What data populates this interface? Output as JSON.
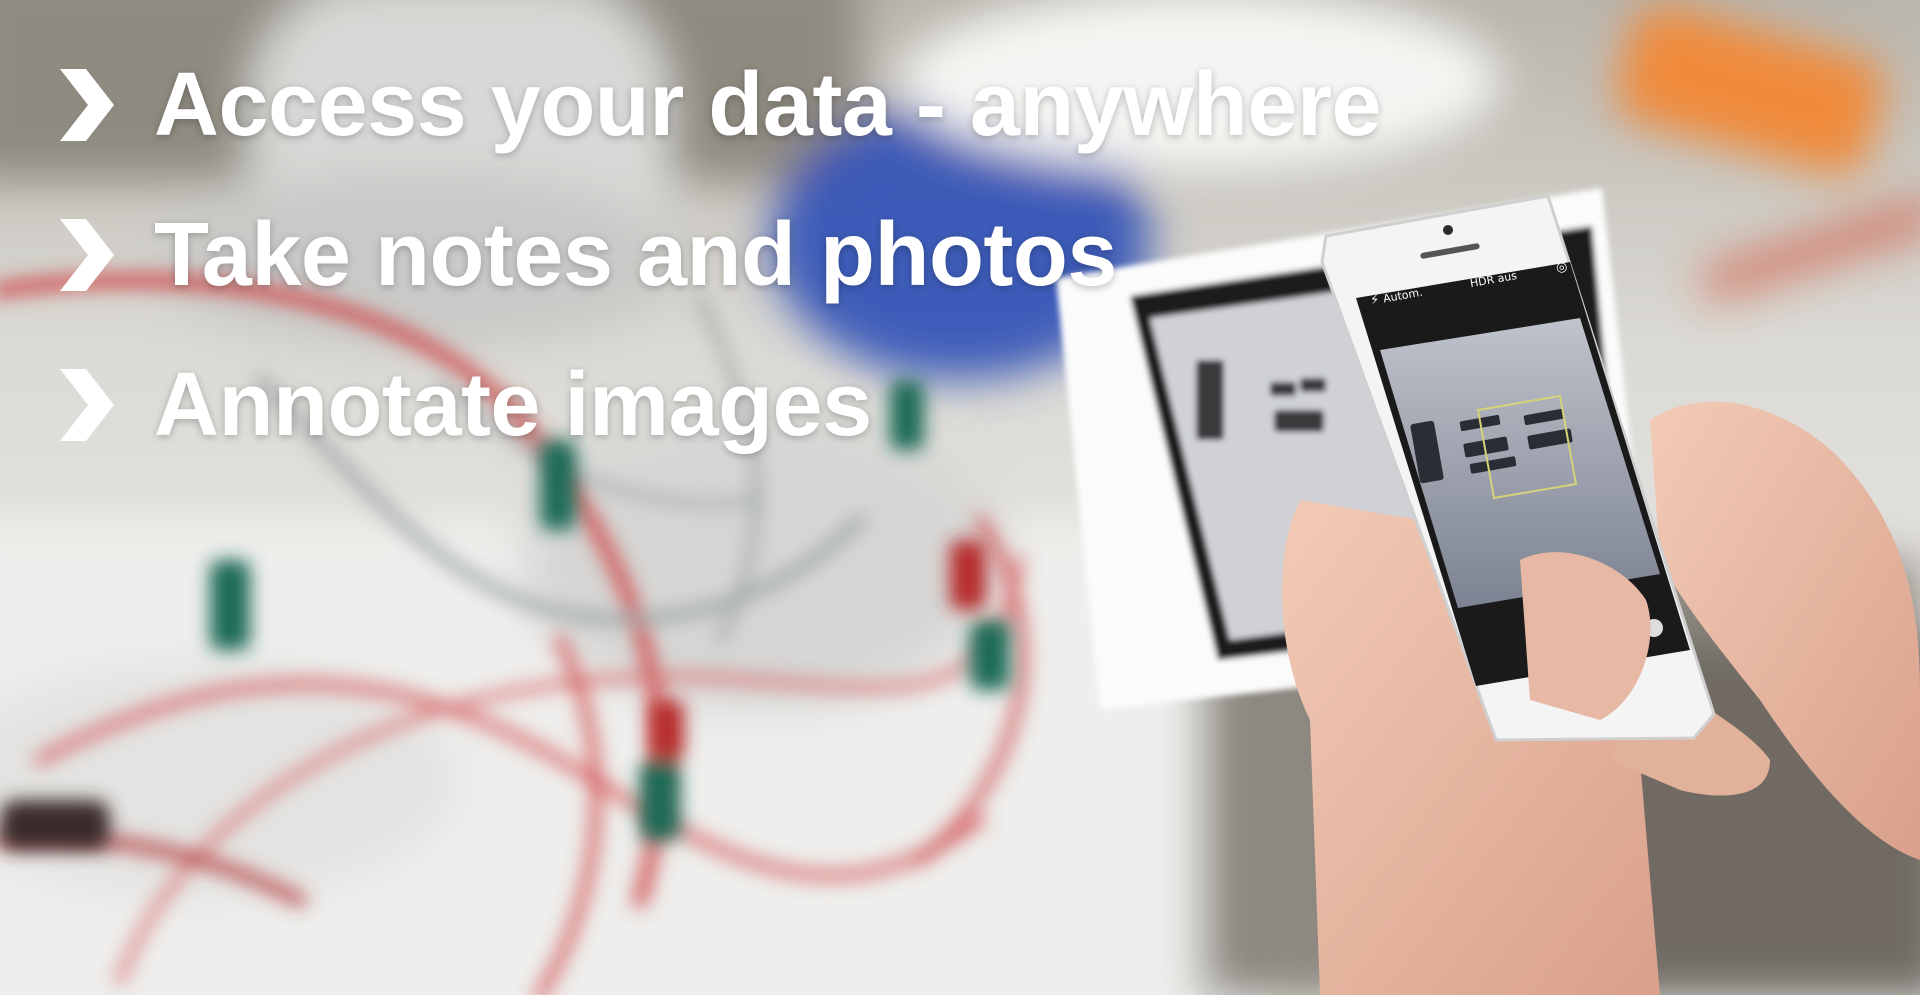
{
  "slide": {
    "bullets": [
      {
        "text": "Access your data - anywhere",
        "icon": "chevron-right-icon"
      },
      {
        "text": "Take notes and photos",
        "icon": "chevron-right-icon"
      },
      {
        "text": "Annotate images",
        "icon": "chevron-right-icon"
      }
    ],
    "phone_screen": {
      "flash_label": "Autom.",
      "hdr_label": "HDR aus"
    }
  },
  "colors": {
    "text": "#ffffff",
    "bench": "#e9e9e8",
    "cable_red": "#cf4a4a",
    "cable_green": "#1c6b56",
    "phone": "#f4f4f4",
    "screen": "#1a1a1a"
  }
}
